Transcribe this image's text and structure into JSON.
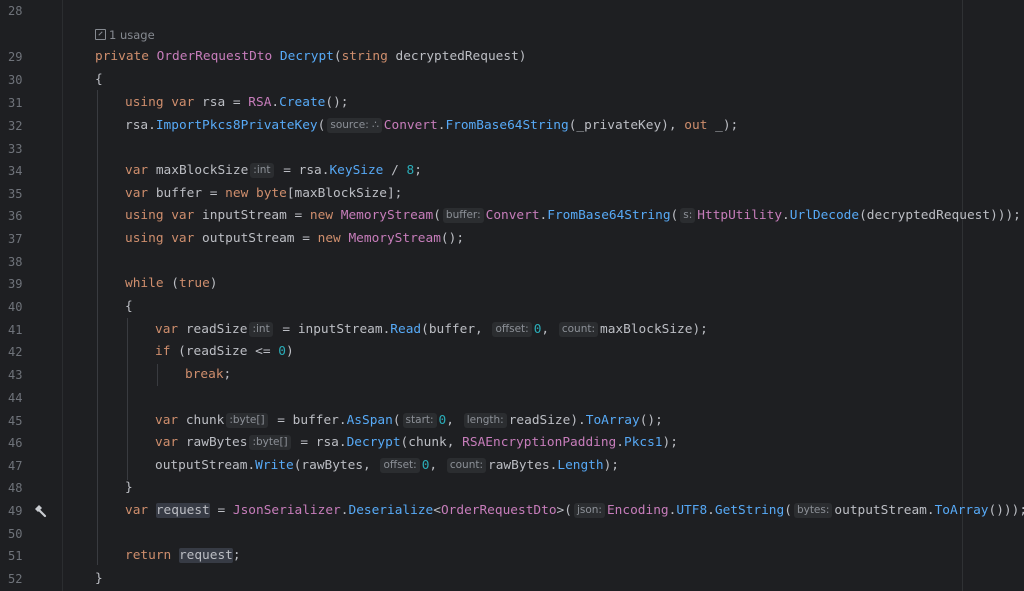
{
  "editor": {
    "usage_hint": "1 usage",
    "lines": [
      {
        "no": "28",
        "indent": 0,
        "parts": []
      },
      {
        "no": "29",
        "indent": 0,
        "parts": [
          [
            "kw",
            "private "
          ],
          [
            "cl",
            "OrderRequestDto "
          ],
          [
            "fn",
            "Decrypt"
          ],
          [
            "",
            "("
          ],
          [
            "kw",
            "string "
          ],
          [
            "",
            "decryptedRequest)"
          ]
        ]
      },
      {
        "no": "30",
        "indent": 0,
        "parts": [
          [
            "",
            "{"
          ]
        ]
      },
      {
        "no": "31",
        "indent": 1,
        "parts": [
          [
            "kw",
            "using var "
          ],
          [
            "",
            "rsa = "
          ],
          [
            "cl",
            "RSA"
          ],
          [
            "",
            "."
          ],
          [
            "fn",
            "Create"
          ],
          [
            "",
            "();"
          ]
        ]
      },
      {
        "no": "32",
        "indent": 1,
        "parts": [
          [
            "",
            "rsa."
          ],
          [
            "mt",
            "ImportPkcs8PrivateKey"
          ],
          [
            "",
            "("
          ],
          [
            "hint",
            "source: ∴"
          ],
          [
            "cl",
            "Convert"
          ],
          [
            "",
            "."
          ],
          [
            "mt",
            "FromBase64String"
          ],
          [
            "",
            "(_privateKey), "
          ],
          [
            "kw",
            "out "
          ],
          [
            "",
            "_);"
          ]
        ]
      },
      {
        "no": "33",
        "indent": 0,
        "parts": []
      },
      {
        "no": "34",
        "indent": 1,
        "parts": [
          [
            "kw",
            "var "
          ],
          [
            "",
            "maxBlockSize"
          ],
          [
            "hint",
            ":int"
          ],
          [
            "",
            " = rsa."
          ],
          [
            "pr",
            "KeySize"
          ],
          [
            "",
            " / "
          ],
          [
            "num",
            "8"
          ],
          [
            "",
            ";"
          ]
        ]
      },
      {
        "no": "35",
        "indent": 1,
        "parts": [
          [
            "kw",
            "var "
          ],
          [
            "",
            "buffer = "
          ],
          [
            "kw",
            "new byte"
          ],
          [
            "",
            "[maxBlockSize];"
          ]
        ]
      },
      {
        "no": "36",
        "indent": 1,
        "parts": [
          [
            "kw",
            "using var "
          ],
          [
            "",
            "inputStream = "
          ],
          [
            "kw",
            "new "
          ],
          [
            "cl",
            "MemoryStream"
          ],
          [
            "",
            "("
          ],
          [
            "hint",
            "buffer:"
          ],
          [
            "cl",
            "Convert"
          ],
          [
            "",
            "."
          ],
          [
            "mt",
            "FromBase64String"
          ],
          [
            "",
            "("
          ],
          [
            "hint",
            "s:"
          ],
          [
            "cl",
            "HttpUtility"
          ],
          [
            "",
            "."
          ],
          [
            "mt",
            "UrlDecode"
          ],
          [
            "",
            "(decryptedRequest)));"
          ]
        ]
      },
      {
        "no": "37",
        "indent": 1,
        "parts": [
          [
            "kw",
            "using var "
          ],
          [
            "",
            "outputStream = "
          ],
          [
            "kw",
            "new "
          ],
          [
            "cl",
            "MemoryStream"
          ],
          [
            "",
            "();"
          ]
        ]
      },
      {
        "no": "38",
        "indent": 0,
        "parts": []
      },
      {
        "no": "39",
        "indent": 1,
        "parts": [
          [
            "kw",
            "while "
          ],
          [
            "",
            "("
          ],
          [
            "kw",
            "true"
          ],
          [
            "",
            ")"
          ]
        ]
      },
      {
        "no": "40",
        "indent": 1,
        "parts": [
          [
            "",
            "{"
          ]
        ]
      },
      {
        "no": "41",
        "indent": 2,
        "parts": [
          [
            "kw",
            "var "
          ],
          [
            "",
            "readSize"
          ],
          [
            "hint",
            ":int"
          ],
          [
            "",
            "",
            " = inputStream."
          ],
          [
            "mt",
            "Read"
          ],
          [
            "",
            "(buffer, "
          ],
          [
            "hint",
            "offset:"
          ],
          [
            "num",
            "0"
          ],
          [
            "",
            ", "
          ],
          [
            "hint",
            "count:"
          ],
          [
            "",
            "maxBlockSize);"
          ]
        ]
      },
      {
        "no": "42",
        "indent": 2,
        "parts": [
          [
            "kw",
            "if "
          ],
          [
            "",
            "(readSize <= "
          ],
          [
            "num",
            "0"
          ],
          [
            "",
            ")"
          ]
        ]
      },
      {
        "no": "43",
        "indent": 3,
        "parts": [
          [
            "kw",
            "break"
          ],
          [
            "",
            ";"
          ]
        ]
      },
      {
        "no": "44",
        "indent": 0,
        "parts": []
      },
      {
        "no": "45",
        "indent": 2,
        "parts": [
          [
            "kw",
            "var "
          ],
          [
            "",
            "chunk"
          ],
          [
            "hint",
            ":byte[]"
          ],
          [
            "",
            " = buffer."
          ],
          [
            "mt",
            "AsSpan"
          ],
          [
            "",
            "("
          ],
          [
            "hint",
            "start:"
          ],
          [
            "num",
            "0"
          ],
          [
            "",
            ", "
          ],
          [
            "hint",
            "length:"
          ],
          [
            "",
            "readSize)."
          ],
          [
            "mt",
            "ToArray"
          ],
          [
            "",
            "();"
          ]
        ]
      },
      {
        "no": "46",
        "indent": 2,
        "parts": [
          [
            "kw",
            "var "
          ],
          [
            "",
            "rawBytes"
          ],
          [
            "hint",
            ":byte[]"
          ],
          [
            "",
            " = rsa."
          ],
          [
            "mt",
            "Decrypt"
          ],
          [
            "",
            "(chunk, "
          ],
          [
            "cl",
            "RSAEncryptionPadding"
          ],
          [
            "",
            "."
          ],
          [
            "pr",
            "Pkcs1"
          ],
          [
            "",
            ");"
          ]
        ]
      },
      {
        "no": "47",
        "indent": 2,
        "parts": [
          [
            "",
            "outputStream."
          ],
          [
            "mt",
            "Write"
          ],
          [
            "",
            "(rawBytes, "
          ],
          [
            "hint",
            "offset:"
          ],
          [
            "num",
            "0"
          ],
          [
            "",
            ", "
          ],
          [
            "hint",
            "count:"
          ],
          [
            "",
            "rawBytes."
          ],
          [
            "pr",
            "Length"
          ],
          [
            "",
            ");"
          ]
        ]
      },
      {
        "no": "48",
        "indent": 1,
        "parts": [
          [
            "",
            "}"
          ]
        ]
      },
      {
        "no": "49",
        "indent": 1,
        "parts": [
          [
            "kw",
            "var "
          ],
          [
            "hl",
            "request"
          ],
          [
            "",
            " = "
          ],
          [
            "cl",
            "JsonSerializer"
          ],
          [
            "",
            "."
          ],
          [
            "mt",
            "Deserialize"
          ],
          [
            "",
            "<"
          ],
          [
            "cl",
            "OrderRequestDto"
          ],
          [
            "",
            ">("
          ],
          [
            "hint",
            "json:"
          ],
          [
            "cl",
            "Encoding"
          ],
          [
            "",
            "."
          ],
          [
            "pr",
            "UTF8"
          ],
          [
            "",
            "."
          ],
          [
            "mt",
            "GetString"
          ],
          [
            "",
            "("
          ],
          [
            "hint",
            "bytes:"
          ],
          [
            "",
            "outputStream."
          ],
          [
            "mt",
            "ToArray"
          ],
          [
            "",
            "()));"
          ]
        ]
      },
      {
        "no": "50",
        "indent": 0,
        "parts": []
      },
      {
        "no": "51",
        "indent": 1,
        "parts": [
          [
            "kw",
            "return "
          ],
          [
            "hl",
            "request"
          ],
          [
            "",
            ";"
          ]
        ]
      },
      {
        "no": "52",
        "indent": 0,
        "parts": [
          [
            "",
            "}"
          ]
        ]
      }
    ],
    "hammer_line": "49"
  }
}
